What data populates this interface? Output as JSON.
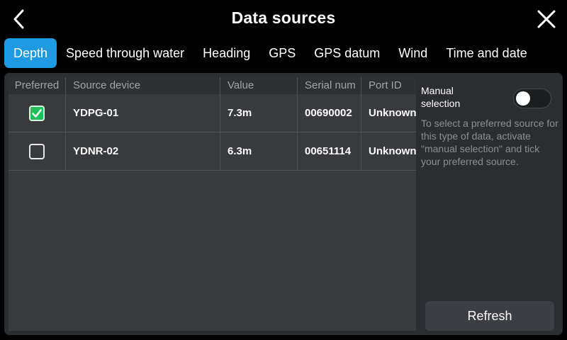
{
  "header": {
    "title": "Data sources",
    "back_icon": "chevron-left-icon",
    "close_icon": "close-icon"
  },
  "tabs": [
    {
      "label": "Depth",
      "active": true
    },
    {
      "label": "Speed through water",
      "active": false
    },
    {
      "label": "Heading",
      "active": false
    },
    {
      "label": "GPS",
      "active": false
    },
    {
      "label": "GPS datum",
      "active": false
    },
    {
      "label": "Wind",
      "active": false
    },
    {
      "label": "Time and date",
      "active": false
    }
  ],
  "table": {
    "columns": [
      "Preferred",
      "Source device",
      "Value",
      "Serial num",
      "Port ID"
    ],
    "rows": [
      {
        "preferred": true,
        "device": "YDPG-01",
        "value": "7.3m",
        "serial": "00690002",
        "port": "Unknown"
      },
      {
        "preferred": false,
        "device": "YDNR-02",
        "value": "6.3m",
        "serial": "00651114",
        "port": "Unknown"
      }
    ]
  },
  "manual_selection": {
    "label": "Manual selection",
    "enabled": false,
    "help": "To select a preferred source for this type of data, activate \"manual selection\" and tick your preferred source."
  },
  "refresh_label": "Refresh",
  "colors": {
    "accent": "#1f9be3",
    "checked": "#1fbf5a",
    "panel": "#2c2d30"
  }
}
